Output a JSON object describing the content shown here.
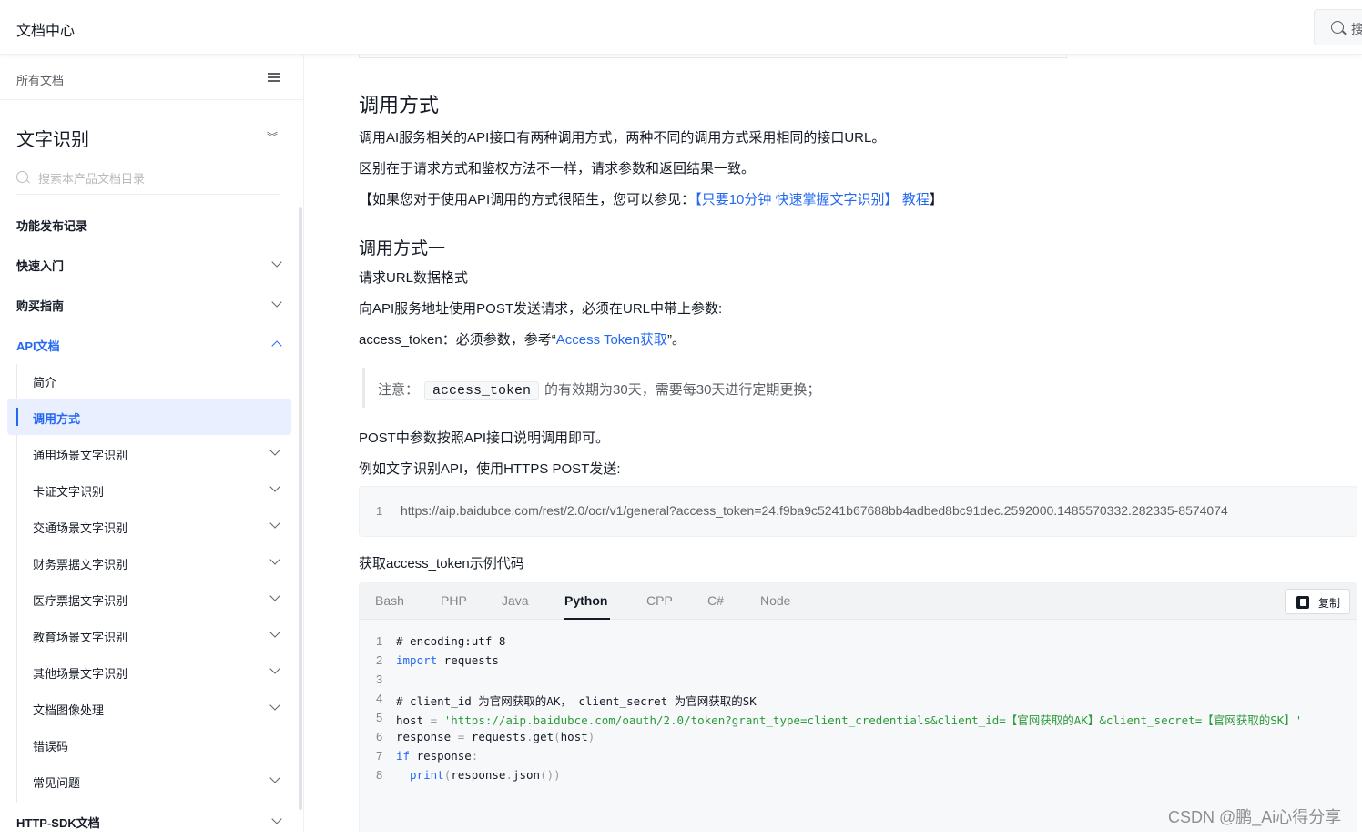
{
  "header": {
    "title": "文档中心",
    "search_label": "搜"
  },
  "sidebar": {
    "all_docs": "所有文档",
    "product": "文字识别",
    "search_placeholder": "搜索本产品文档目录",
    "nav": [
      {
        "label": "功能发布记录"
      },
      {
        "label": "快速入门"
      },
      {
        "label": "购买指南"
      },
      {
        "label": "API文档"
      },
      {
        "label": "HTTP-SDK文档"
      }
    ],
    "api_sub": [
      {
        "label": "简介"
      },
      {
        "label": "调用方式"
      },
      {
        "label": "通用场景文字识别"
      },
      {
        "label": "卡证文字识别"
      },
      {
        "label": "交通场景文字识别"
      },
      {
        "label": "财务票据文字识别"
      },
      {
        "label": "医疗票据文字识别"
      },
      {
        "label": "教育场景文字识别"
      },
      {
        "label": "其他场景文字识别"
      },
      {
        "label": "文档图像处理"
      },
      {
        "label": "错误码"
      },
      {
        "label": "常见问题"
      }
    ]
  },
  "content": {
    "h2": "调用方式",
    "p1": "调用AI服务相关的API接口有两种调用方式，两种不同的调用方式采用相同的接口URL。",
    "p2": "区别在于请求方式和鉴权方法不一样，请求参数和返回结果一致。",
    "p3_prefix": "【如果您对于使用API调用的方式很陌生，您可以参见：",
    "p3_link": "【只要10分钟 快速掌握文字识别】 教程",
    "p3_suffix": "】",
    "h3": "调用方式一",
    "p4": "请求URL数据格式",
    "p5": "向API服务地址使用POST发送请求，必须在URL中带上参数:",
    "p6_prefix": "access_token：必须参数，参考“",
    "p6_link": "Access Token获取",
    "p6_suffix": "”。",
    "note_prefix": "注意：",
    "note_code": "access_token",
    "note_suffix": "的有效期为30天，需要每30天进行定期更换；",
    "p7": "POST中参数按照API接口说明调用即可。",
    "p8": "例如文字识别API，使用HTTPS POST发送:",
    "url_line_no": "1",
    "url": "https://aip.baidubce.com/rest/2.0/ocr/v1/general?access_token=24.f9ba9c5241b67688bb4adbed8bc91dec.2592000.1485570332.282335-8574074",
    "p9": "获取access_token示例代码"
  },
  "codebox": {
    "tabs": [
      "Bash",
      "PHP",
      "Java",
      "Python",
      "CPP",
      "C#",
      "Node"
    ],
    "active_tab": "Python",
    "copy_label": "复制",
    "lines": [
      {
        "n": "1",
        "text": " # encoding:utf-8"
      },
      {
        "n": "2",
        "kw": "import",
        "text": " requests"
      },
      {
        "n": "3",
        "text": ""
      },
      {
        "n": "4",
        "text": "# client_id 为官网获取的AK， client_secret 为官网获取的SK"
      },
      {
        "n": "5",
        "pre": "host",
        "op": " = ",
        "str": "'https://aip.baidubce.com/oauth/2.0/token?grant_type=client_credentials&client_id=【官网获取的AK】&client_secret=【官网获取的SK】'"
      },
      {
        "n": "6",
        "pre": "response",
        "op": " = ",
        "mid": "requests",
        "dot": ".",
        "fn": "get",
        "p1": "(",
        "arg": "host",
        "p2": ")"
      },
      {
        "n": "7",
        "kw": "if",
        "pre": " response",
        "op": ":"
      },
      {
        "n": "8",
        "kw": "  print",
        "p1": "(",
        "arg": "response",
        "dot": ".",
        "fn": "json",
        "p2": "())"
      }
    ]
  },
  "watermark": "CSDN @鹏_Ai心得分享"
}
